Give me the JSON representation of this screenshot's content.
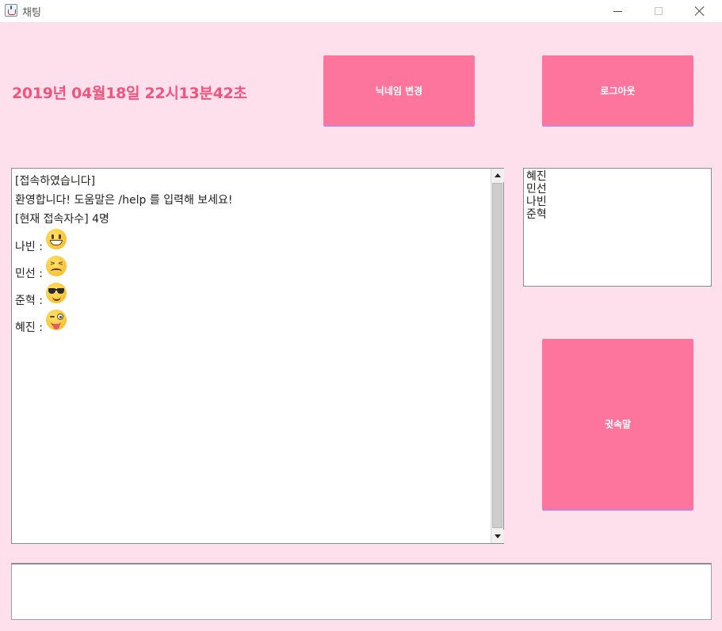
{
  "window": {
    "title": "채팅",
    "icon": "java-cup-icon"
  },
  "header": {
    "datetime": "2019년 04월18일 22시13분42초",
    "nickname_button": "닉네임 변경",
    "logout_button": "로그아웃"
  },
  "chat": {
    "messages": [
      "[접속하였습니다]",
      "환영합니다! 도움말은 /help 를 입력해 보세요!",
      "[현재 접속자수] 4명"
    ],
    "emoji_messages": [
      {
        "sender": "나빈 :",
        "emoji": "grinning-face"
      },
      {
        "sender": "민선 :",
        "emoji": "confounded-face"
      },
      {
        "sender": "준혁 :",
        "emoji": "smiling-face-with-sunglasses"
      },
      {
        "sender": "혜진 :",
        "emoji": "winking-face-with-tongue"
      }
    ]
  },
  "users": [
    "혜진",
    "민선",
    "나빈",
    "준혁"
  ],
  "whisper_button": "귓속말",
  "input": {
    "value": ""
  },
  "colors": {
    "background": "#fde0ec",
    "button": "#fd749c",
    "datetime": "#f0557d"
  }
}
